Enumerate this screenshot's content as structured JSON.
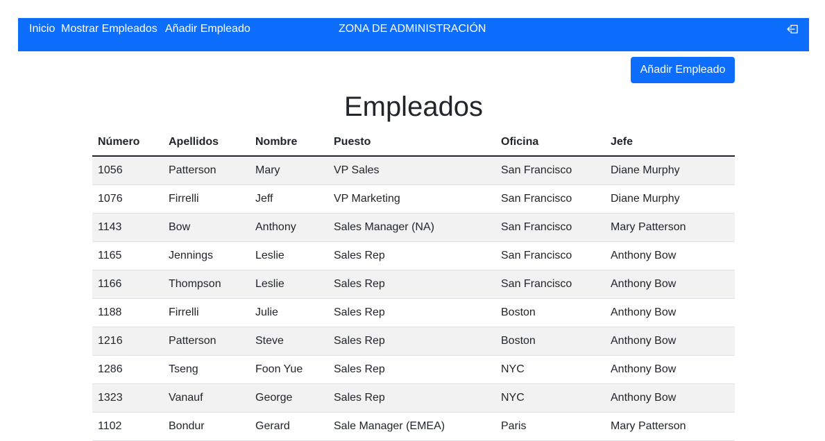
{
  "nav": {
    "inicio": "Inicio",
    "mostrar": "Mostrar Empleados",
    "anadir": "Añadir Empleado",
    "title": "ZONA DE ADMINISTRACIÓN",
    "logout_icon": "logout-icon"
  },
  "add_button_label": "Añadir Empleado",
  "page_title": "Empleados",
  "colors": {
    "primary": "#0d6efd",
    "stripe": "#f2f2f2"
  },
  "table": {
    "headers": [
      "Número",
      "Apellidos",
      "Nombre",
      "Puesto",
      "Oficina",
      "Jefe"
    ],
    "rows": [
      [
        "1056",
        "Patterson",
        "Mary",
        "VP Sales",
        "San Francisco",
        "Diane Murphy"
      ],
      [
        "1076",
        "Firrelli",
        "Jeff",
        "VP Marketing",
        "San Francisco",
        "Diane Murphy"
      ],
      [
        "1143",
        "Bow",
        "Anthony",
        "Sales Manager (NA)",
        "San Francisco",
        "Mary Patterson"
      ],
      [
        "1165",
        "Jennings",
        "Leslie",
        "Sales Rep",
        "San Francisco",
        "Anthony Bow"
      ],
      [
        "1166",
        "Thompson",
        "Leslie",
        "Sales Rep",
        "San Francisco",
        "Anthony Bow"
      ],
      [
        "1188",
        "Firrelli",
        "Julie",
        "Sales Rep",
        "Boston",
        "Anthony Bow"
      ],
      [
        "1216",
        "Patterson",
        "Steve",
        "Sales Rep",
        "Boston",
        "Anthony Bow"
      ],
      [
        "1286",
        "Tseng",
        "Foon Yue",
        "Sales Rep",
        "NYC",
        "Anthony Bow"
      ],
      [
        "1323",
        "Vanauf",
        "George",
        "Sales Rep",
        "NYC",
        "Anthony Bow"
      ],
      [
        "1102",
        "Bondur",
        "Gerard",
        "Sale Manager (EMEA)",
        "Paris",
        "Mary Patterson"
      ]
    ]
  }
}
